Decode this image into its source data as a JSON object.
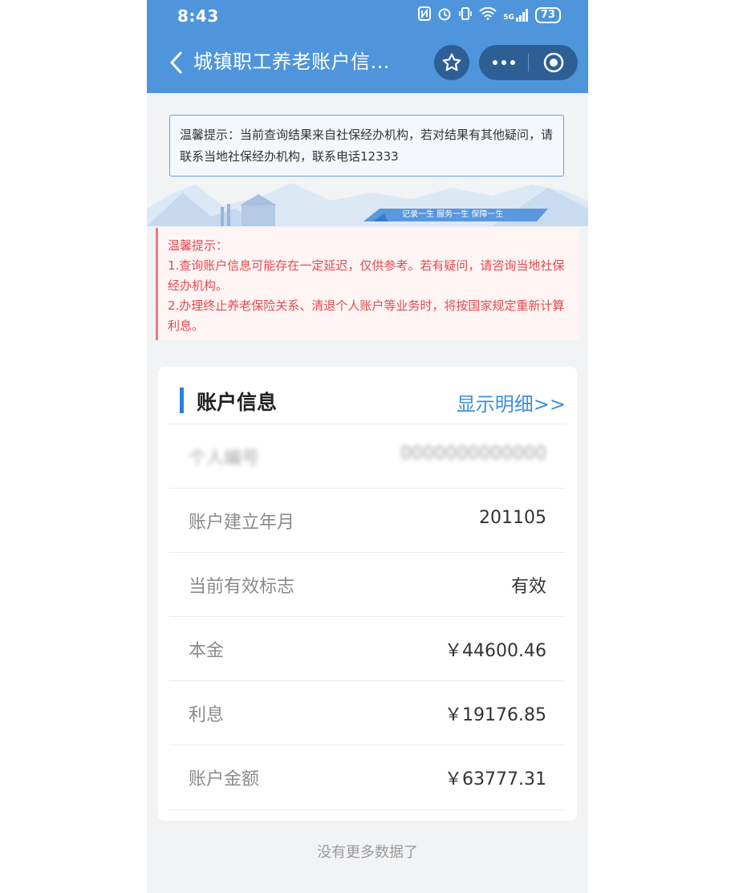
{
  "status_bar": {
    "time": "8:43",
    "network": "5G",
    "battery": "73"
  },
  "header": {
    "title": "城镇职工养老账户信…"
  },
  "notice_top": {
    "text": "温馨提示：当前查询结果来自社保经办机构，若对结果有其他疑问，请联系当地社保经办机构，联系电话12333"
  },
  "banner": {
    "slogan": "记录一生 服务一生 保障一生"
  },
  "notice_warning": {
    "title": "温馨提示：",
    "line1": "1.查询账户信息可能存在一定延迟，仅供参考。若有疑问，请咨询当地社保经办机构。",
    "line2": "2.办理终止养老保险关系、清退个人账户等业务时，将按国家规定重新计算利息。"
  },
  "account_card": {
    "title": "账户信息",
    "detail_link": "显示明细>>",
    "rows": [
      {
        "label": "个人编号",
        "value": "0000000000000"
      },
      {
        "label": "账户建立年月",
        "value": "201105"
      },
      {
        "label": "当前有效标志",
        "value": "有效"
      },
      {
        "label": "本金",
        "value": "￥44600.46"
      },
      {
        "label": "利息",
        "value": "￥19176.85"
      },
      {
        "label": "账户金额",
        "value": "￥63777.31"
      }
    ]
  },
  "footer": {
    "text": "没有更多数据了"
  },
  "colors": {
    "header_bg": "#4e95dc",
    "accent": "#2b80e0",
    "warning_text": "#e5494d",
    "link": "#3d8fdb"
  }
}
